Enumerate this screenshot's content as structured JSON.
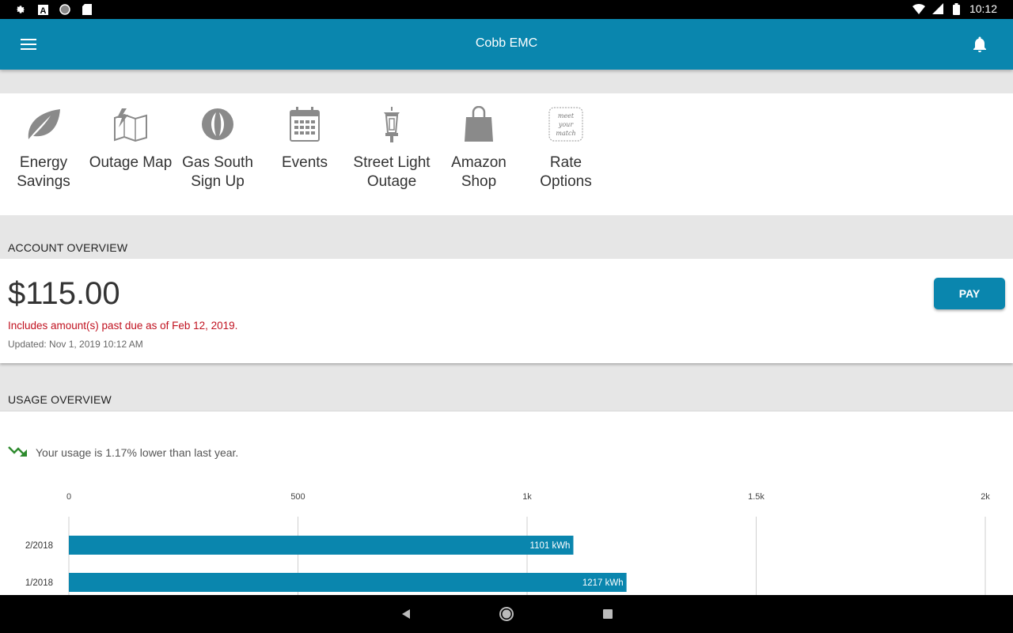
{
  "status_bar": {
    "time": "10:12"
  },
  "app_bar": {
    "title": "Cobb EMC"
  },
  "quick_links": [
    {
      "label": "Energy Savings",
      "icon": "leaf-icon"
    },
    {
      "label": "Outage Map",
      "icon": "map-icon"
    },
    {
      "label": "Gas South Sign Up",
      "icon": "flame-icon"
    },
    {
      "label": "Events",
      "icon": "calendar-icon"
    },
    {
      "label": "Street Light Outage",
      "icon": "street-light-icon"
    },
    {
      "label": "Amazon Shop",
      "icon": "shopping-bag-icon"
    },
    {
      "label": "Rate Options",
      "icon": "meet-your-match-icon",
      "icon_text": "meet your match"
    }
  ],
  "account": {
    "section_title": "ACCOUNT OVERVIEW",
    "amount": "$115.00",
    "past_due": "Includes amount(s) past due as of Feb 12, 2019.",
    "updated": "Updated:  Nov 1, 2019 10:12 AM",
    "pay_label": "PAY"
  },
  "usage": {
    "section_title": "USAGE OVERVIEW",
    "trend_text": "Your usage is 1.17% lower than last year."
  },
  "colors": {
    "brand": "#0a86ae",
    "alert": "#c0111f",
    "trend_down": "#2e8b2e"
  },
  "chart_data": {
    "type": "bar",
    "orientation": "horizontal",
    "categories": [
      "2/2018",
      "1/2018"
    ],
    "values": [
      1101,
      1217
    ],
    "value_labels": [
      "1101 kWh",
      "1217 kWh"
    ],
    "xlim": [
      0,
      2000
    ],
    "ticks": [
      0,
      500,
      1000,
      1500,
      2000
    ],
    "tick_labels": [
      "0",
      "500",
      "1k",
      "1.5k",
      "2k"
    ],
    "grid": true
  }
}
